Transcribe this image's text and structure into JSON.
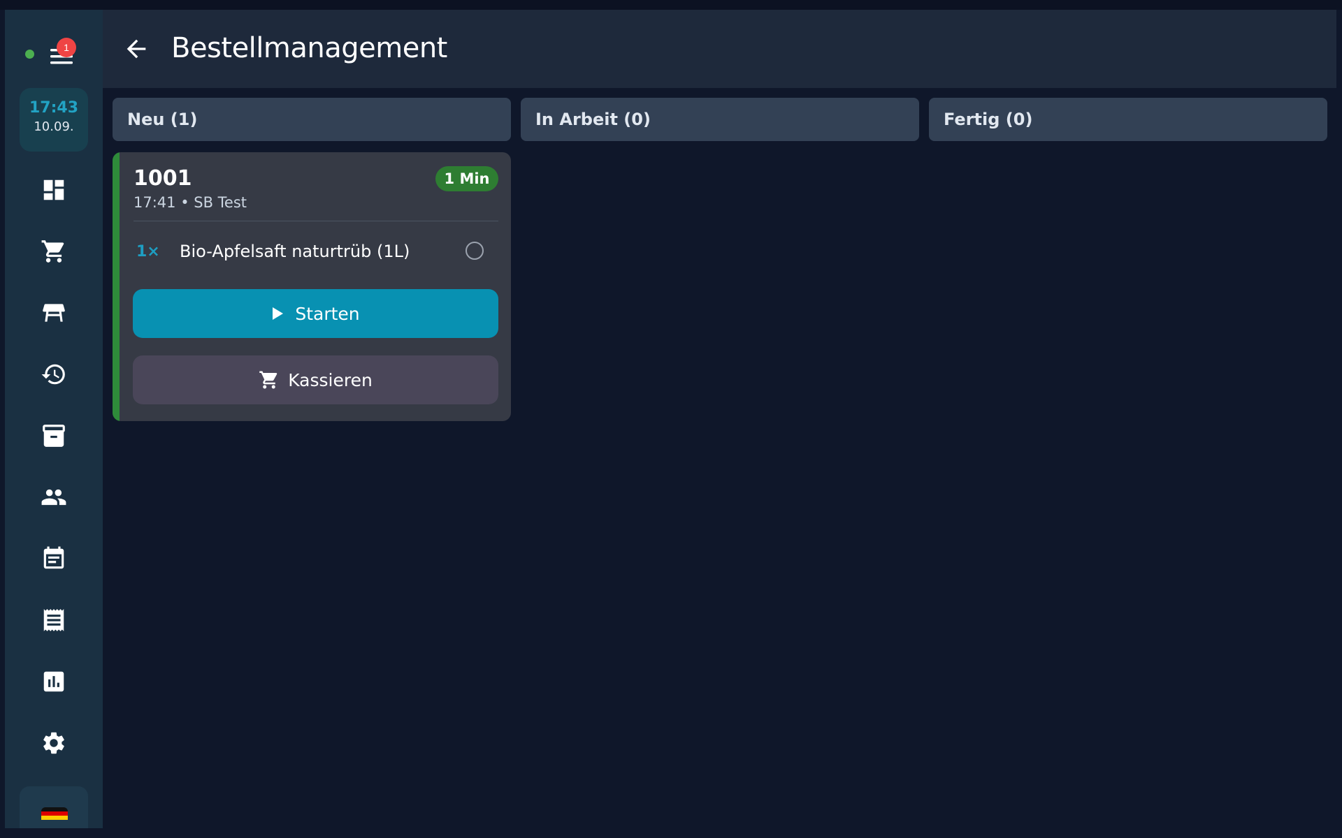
{
  "header": {
    "title": "Bestellmanagement"
  },
  "sidebar": {
    "notification_count": "1",
    "clock": {
      "time": "17:43",
      "date": "10.09."
    },
    "items": [
      {
        "name": "dashboard"
      },
      {
        "name": "cart"
      },
      {
        "name": "tables"
      },
      {
        "name": "history"
      },
      {
        "name": "archive"
      },
      {
        "name": "customers"
      },
      {
        "name": "calendar"
      },
      {
        "name": "receipts"
      },
      {
        "name": "reports"
      },
      {
        "name": "settings"
      }
    ],
    "language_flag": "de"
  },
  "columns": [
    {
      "label": "Neu (1)"
    },
    {
      "label": "In Arbeit (0)"
    },
    {
      "label": "Fertig (0)"
    }
  ],
  "order": {
    "number": "1001",
    "meta": "17:41 • SB Test",
    "elapsed": "1 Min",
    "item": {
      "qty": "1×",
      "name": "Bio-Apfelsaft naturtrüb (1L)"
    },
    "start_label": "Starten",
    "checkout_label": "Kassieren"
  },
  "colors": {
    "accent": "#0891b2",
    "success": "#2e7d32",
    "badge": "#ef4444",
    "background": "#0f172a"
  }
}
